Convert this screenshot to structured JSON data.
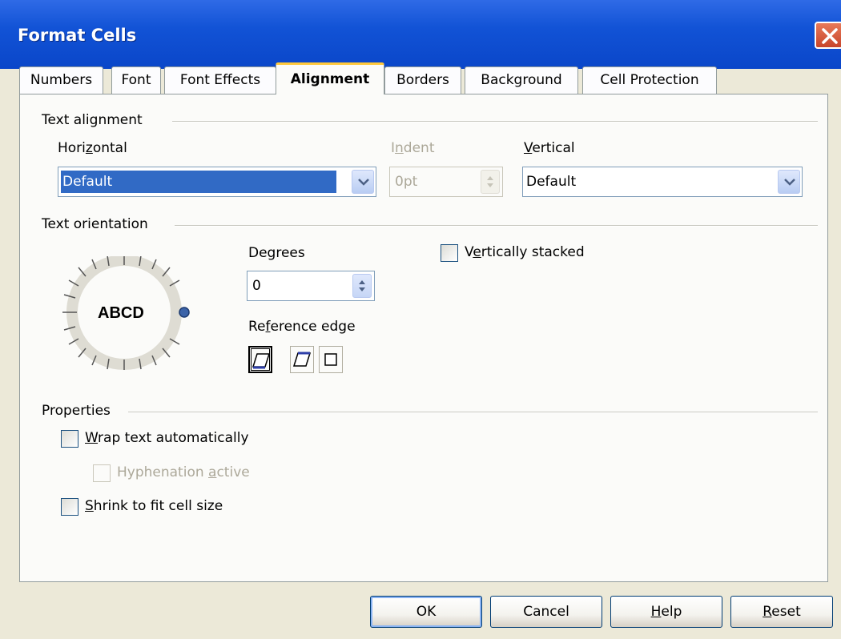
{
  "window": {
    "title": "Format Cells"
  },
  "tabs": [
    {
      "label": "Numbers"
    },
    {
      "label": "Font"
    },
    {
      "label": "Font Effects"
    },
    {
      "label": "Alignment",
      "active": true
    },
    {
      "label": "Borders"
    },
    {
      "label": "Background"
    },
    {
      "label": "Cell Protection"
    }
  ],
  "text_alignment": {
    "group_label": "Text alignment",
    "horizontal_label": "Horizontal",
    "horizontal_value": "Default",
    "indent_label": "Indent",
    "indent_value": "0pt",
    "vertical_label": "Vertical",
    "vertical_value": "Default"
  },
  "text_orientation": {
    "group_label": "Text orientation",
    "dial_text": "ABCD",
    "degrees_label": "Degrees",
    "degrees_value": "0",
    "reference_edge_label": "Reference edge",
    "vertically_stacked_label": "Vertically stacked",
    "vertically_stacked_checked": false
  },
  "properties": {
    "group_label": "Properties",
    "wrap_label": "Wrap text automatically",
    "hyphenation_label": "Hyphenation active",
    "shrink_label": "Shrink to fit cell size"
  },
  "buttons": {
    "ok": "OK",
    "cancel": "Cancel",
    "help": "Help",
    "reset": "Reset"
  },
  "colors": {
    "titlebar": "#0a46c9",
    "selection": "#316ac5",
    "dialog_bg": "#ece9d8",
    "active_tab_accent": "#ffc83c"
  }
}
